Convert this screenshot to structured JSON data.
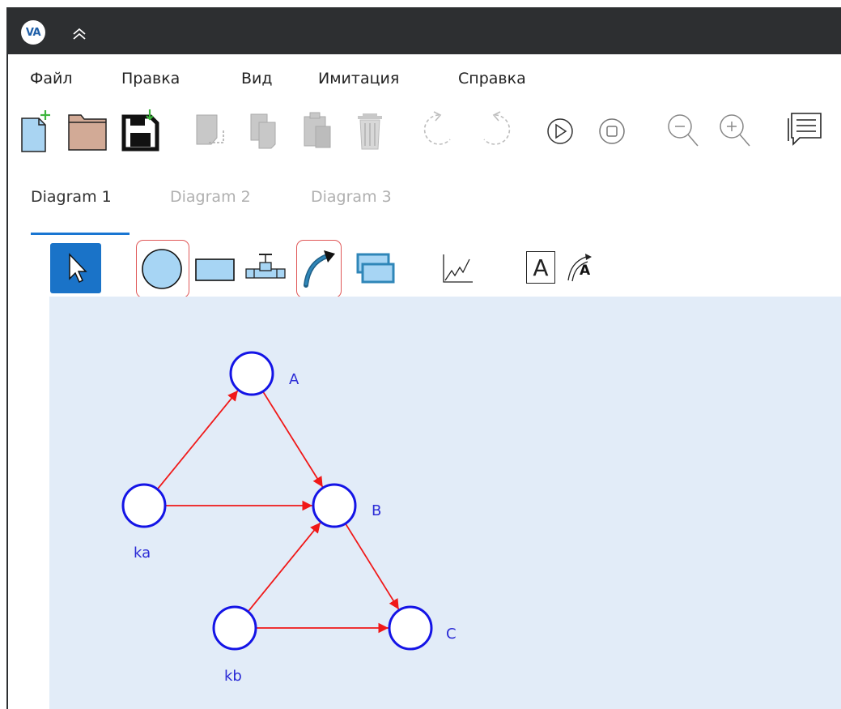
{
  "app": {
    "logo_text": "VA"
  },
  "menu": {
    "items": [
      {
        "label": "Файл"
      },
      {
        "label": "Правка"
      },
      {
        "label": "Вид"
      },
      {
        "label": "Имитация"
      },
      {
        "label": "Справка"
      }
    ]
  },
  "toolbar": {
    "buttons": [
      {
        "icon": "new-file-icon"
      },
      {
        "icon": "open-folder-icon"
      },
      {
        "icon": "save-icon"
      },
      {
        "icon": "cut-icon",
        "disabled": true
      },
      {
        "icon": "copy-icon",
        "disabled": true
      },
      {
        "icon": "paste-icon",
        "disabled": true
      },
      {
        "icon": "delete-icon",
        "disabled": true
      },
      {
        "icon": "undo-icon",
        "disabled": true
      },
      {
        "icon": "redo-icon",
        "disabled": true
      },
      {
        "icon": "play-icon"
      },
      {
        "icon": "stop-icon"
      },
      {
        "icon": "zoom-out-icon"
      },
      {
        "icon": "zoom-in-icon"
      },
      {
        "icon": "comments-icon"
      }
    ]
  },
  "tabs": [
    {
      "label": "Diagram 1",
      "active": true
    },
    {
      "label": "Diagram 2",
      "active": false
    },
    {
      "label": "Diagram 3",
      "active": false
    }
  ],
  "palette": {
    "text_tool_label": "A",
    "curved_text_tool_label": "A",
    "highlighted_tools": [
      "circle-node-tool",
      "arc-tool"
    ]
  },
  "diagram": {
    "nodes": [
      {
        "id": "A",
        "label": "A"
      },
      {
        "id": "B",
        "label": "B"
      },
      {
        "id": "C",
        "label": "C"
      },
      {
        "id": "ka",
        "label": "ka"
      },
      {
        "id": "kb",
        "label": "kb"
      }
    ],
    "edges": [
      {
        "from": "ka",
        "to": "A"
      },
      {
        "from": "ka",
        "to": "B"
      },
      {
        "from": "A",
        "to": "B"
      },
      {
        "from": "kb",
        "to": "B"
      },
      {
        "from": "B",
        "to": "C"
      },
      {
        "from": "kb",
        "to": "C"
      }
    ],
    "colors": {
      "node_stroke": "#1414e6",
      "node_fill": "#ffffff",
      "label": "#2b2bd6",
      "edge": "#f01818"
    }
  },
  "colors": {
    "titlebar": "#2d2f31",
    "canvas_bg": "#e2ecf8",
    "accent": "#1a73c8",
    "highlight": "#e05858"
  }
}
